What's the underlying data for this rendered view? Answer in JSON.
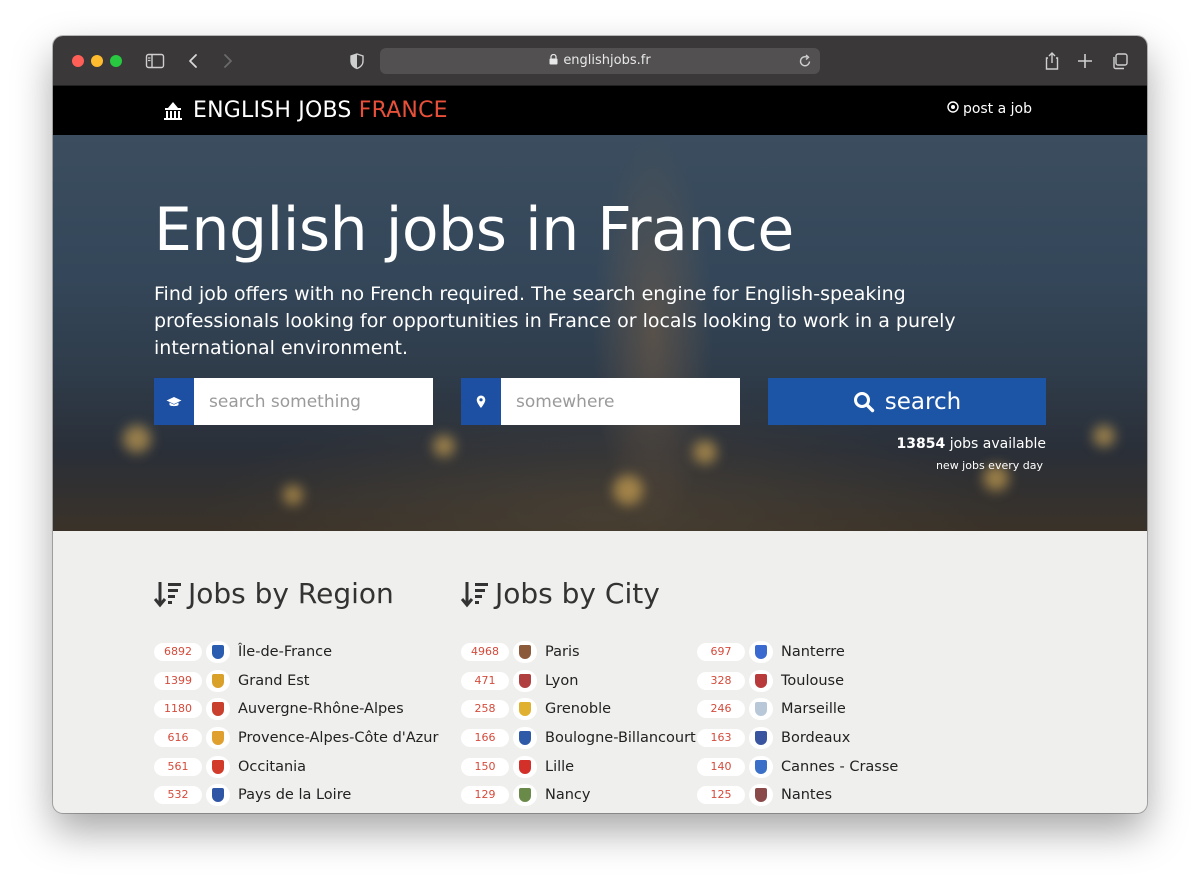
{
  "browser": {
    "url": "englishjobs.fr"
  },
  "header": {
    "logo_main": "ENGLISH JOBS",
    "logo_accent": "FRANCE",
    "post_job": "post a job"
  },
  "hero": {
    "title": "English jobs in France",
    "subtitle": "Find job offers with no French required. The search engine for English-speaking professionals looking for opportunities in France or locals looking to work in a purely international environment.",
    "search_placeholder": "search something",
    "location_placeholder": "somewhere",
    "search_button": "search",
    "jobs_count": "13854",
    "jobs_label": "jobs available",
    "jobs_sub": "new jobs every day"
  },
  "regions": {
    "title": "Jobs by Region",
    "items": [
      {
        "count": "6892",
        "label": "Île-de-France",
        "color": "#2a5db0"
      },
      {
        "count": "1399",
        "label": "Grand Est",
        "color": "#d9a02a"
      },
      {
        "count": "1180",
        "label": "Auvergne-Rhône-Alpes",
        "color": "#c9402f"
      },
      {
        "count": "616",
        "label": "Provence-Alpes-Côte d'Azur",
        "color": "#e0a030"
      },
      {
        "count": "561",
        "label": "Occitania",
        "color": "#d23a2a"
      },
      {
        "count": "532",
        "label": "Pays de la Loire",
        "color": "#2f55a5"
      }
    ]
  },
  "cities": {
    "title": "Jobs by City",
    "col1": [
      {
        "count": "4968",
        "label": "Paris",
        "color": "#8a5a3a"
      },
      {
        "count": "471",
        "label": "Lyon",
        "color": "#b04040"
      },
      {
        "count": "258",
        "label": "Grenoble",
        "color": "#e0b030"
      },
      {
        "count": "166",
        "label": "Boulogne-Billancourt",
        "color": "#2f5aa8"
      },
      {
        "count": "150",
        "label": "Lille",
        "color": "#d4302a"
      },
      {
        "count": "129",
        "label": "Nancy",
        "color": "#6a8a4a"
      }
    ],
    "col2": [
      {
        "count": "697",
        "label": "Nanterre",
        "color": "#3a6ad0"
      },
      {
        "count": "328",
        "label": "Toulouse",
        "color": "#b83a3a"
      },
      {
        "count": "246",
        "label": "Marseille",
        "color": "#b8c8d8"
      },
      {
        "count": "163",
        "label": "Bordeaux",
        "color": "#3a55a0"
      },
      {
        "count": "140",
        "label": "Cannes - Crasse",
        "color": "#3a70c8"
      },
      {
        "count": "125",
        "label": "Nantes",
        "color": "#8a4a4a"
      }
    ]
  }
}
